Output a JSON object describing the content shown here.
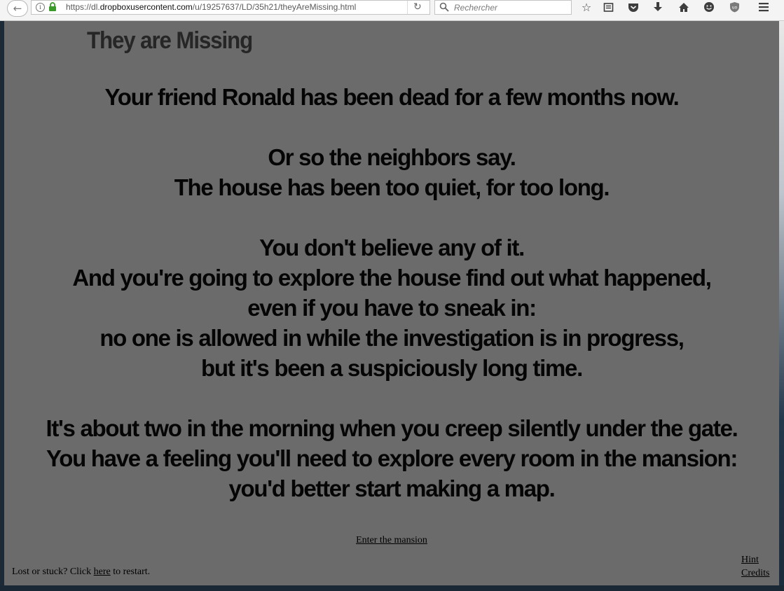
{
  "browser": {
    "url_prefix": "https://dl.",
    "url_domain": "dropboxusercontent.com",
    "url_path": "/u/19257637/LD/35h21/theyAreMissing.html",
    "search_placeholder": "Rechercher"
  },
  "toolbar_icons": [
    "star-icon",
    "reading-list-icon",
    "pocket-icon",
    "download-icon",
    "home-icon",
    "hello-icon",
    "ublock-icon",
    "menu-icon"
  ],
  "game": {
    "title": "They are Missing",
    "story": [
      "Your friend Ronald has been dead for a few months now.",
      "",
      "Or so the neighbors say.",
      "The house has been too quiet, for too long.",
      "",
      "You don't believe any of it.",
      "And you're going to explore the house find out what happened,",
      "even if you have to sneak in:",
      "no one is allowed in while the investigation is in progress,",
      "but it's been a suspiciously long time.",
      "",
      "It's about two in the morning when you creep silently under the gate.",
      "You have a feeling you'll need to explore every room in the mansion:",
      "you'd better start making a map."
    ],
    "enter_link": "Enter the mansion",
    "restart_prefix": "Lost or stuck? Click ",
    "restart_link": "here",
    "restart_suffix": " to restart.",
    "hint_link": "Hint",
    "credits_link": "Credits"
  },
  "colors": {
    "page_background": "#6b6b6b",
    "story_text": "#050505",
    "title_text": "#262626"
  }
}
